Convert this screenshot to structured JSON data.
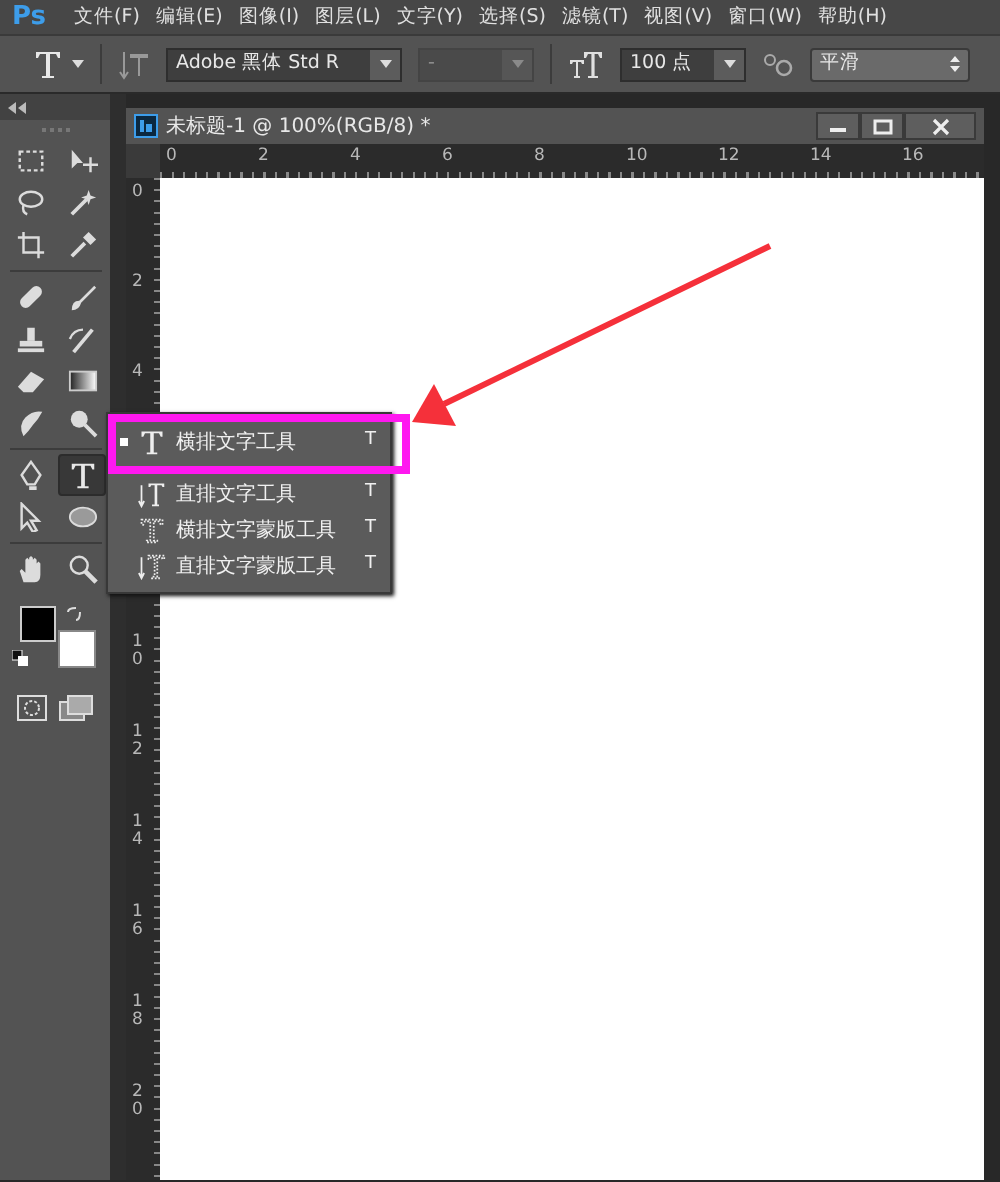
{
  "menu_bar": {
    "logo": "Ps",
    "items": [
      "文件(F)",
      "编辑(E)",
      "图像(I)",
      "图层(L)",
      "文字(Y)",
      "选择(S)",
      "滤镜(T)",
      "视图(V)",
      "窗口(W)",
      "帮助(H)"
    ]
  },
  "options_bar": {
    "font_family": "Adobe 黑体 Std R",
    "font_style": {
      "value": "-",
      "disabled": true
    },
    "font_size": "100 点",
    "anti_alias": "平滑"
  },
  "tools": [
    {
      "selected": false
    },
    {
      "selected": false
    },
    {
      "selected": false
    },
    {
      "selected": false
    },
    {
      "selected": false
    },
    {
      "selected": false
    },
    {
      "selected": false
    },
    {
      "selected": false
    },
    {
      "selected": false
    },
    {
      "selected": false
    },
    {
      "selected": false
    },
    {
      "selected": false
    },
    {
      "selected": false
    },
    {
      "selected": false
    },
    {
      "selected": false
    },
    {
      "selected": true
    },
    {
      "selected": false
    },
    {
      "selected": false
    },
    {
      "selected": false
    },
    {
      "selected": false
    }
  ],
  "document": {
    "title": "未标题-1 @ 100%(RGB/8) *",
    "horizontal_ruler": [
      "0",
      "2",
      "4",
      "6",
      "8",
      "10",
      "12",
      "14",
      "16"
    ],
    "vertical_ruler": [
      "0",
      "2",
      "4",
      "10",
      "12",
      "14",
      "16",
      "18",
      "20"
    ]
  },
  "flyout": {
    "items": [
      {
        "kind": "horizontal",
        "label": "横排文字工具",
        "shortcut": "T",
        "selected": true
      },
      {
        "kind": "vertical",
        "label": "直排文字工具",
        "shortcut": "T",
        "selected": false
      },
      {
        "kind": "horizontal-mask",
        "label": "横排文字蒙版工具",
        "shortcut": "T",
        "selected": false
      },
      {
        "kind": "vertical-mask",
        "label": "直排文字蒙版工具",
        "shortcut": "T",
        "selected": false
      }
    ]
  }
}
